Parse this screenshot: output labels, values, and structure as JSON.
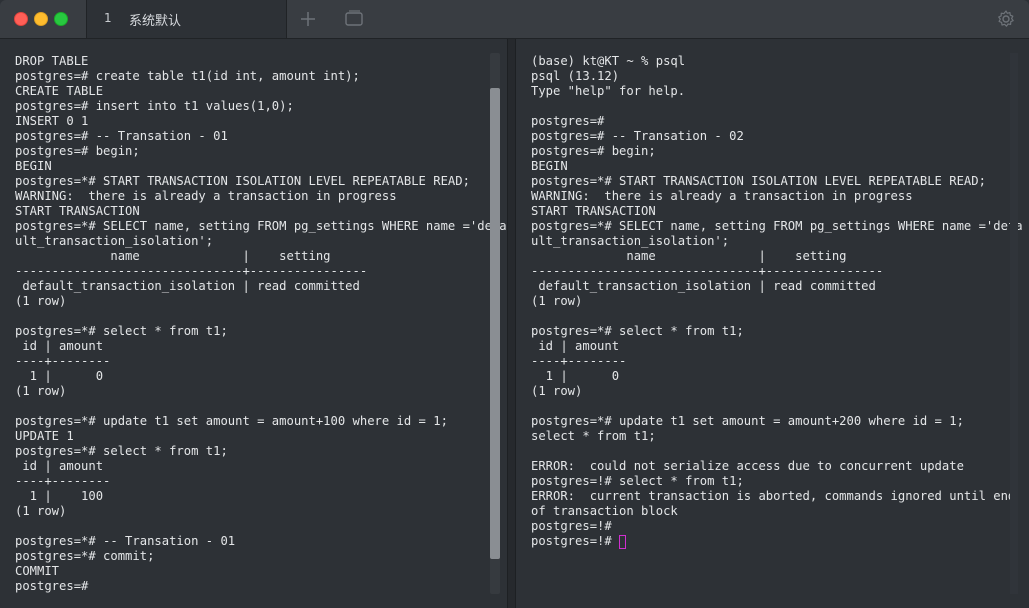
{
  "window": {
    "tab": {
      "number": "1",
      "title": "系统默认"
    },
    "icons": {
      "close": "close-button",
      "minimize": "minimize-button",
      "zoom": "zoom-button",
      "new_tab": "plus-icon",
      "overview": "tab-overview-icon",
      "settings": "gear-icon"
    },
    "colors": {
      "cursor": "#d02fd0",
      "text": "#e4e6e8",
      "background": "#2d3136"
    }
  },
  "left_pane": {
    "scrollbar": {
      "position_fraction": 0.13,
      "visible_fraction": 0.87
    },
    "lines": [
      "DROP TABLE",
      "postgres=# create table t1(id int, amount int);",
      "CREATE TABLE",
      "postgres=# insert into t1 values(1,0);",
      "INSERT 0 1",
      "postgres=# -- Transation - 01",
      "postgres=# begin;",
      "BEGIN",
      "postgres=*# START TRANSACTION ISOLATION LEVEL REPEATABLE READ;",
      "WARNING:  there is already a transaction in progress",
      "START TRANSACTION",
      "postgres=*# SELECT name, setting FROM pg_settings WHERE name ='defa",
      "ult_transaction_isolation';",
      "             name              |    setting",
      "-------------------------------+----------------",
      " default_transaction_isolation | read committed",
      "(1 row)",
      "",
      "postgres=*# select * from t1;",
      " id | amount",
      "----+--------",
      "  1 |      0",
      "(1 row)",
      "",
      "postgres=*# update t1 set amount = amount+100 where id = 1;",
      "UPDATE 1",
      "postgres=*# select * from t1;",
      " id | amount",
      "----+--------",
      "  1 |    100",
      "(1 row)",
      "",
      "postgres=*# -- Transation - 01",
      "postgres=*# commit;",
      "COMMIT",
      "postgres=#"
    ]
  },
  "right_pane": {
    "lines": [
      "(base) kt@KT ~ % psql",
      "psql (13.12)",
      "Type \"help\" for help.",
      "",
      "postgres=#",
      "postgres=# -- Transation - 02",
      "postgres=# begin;",
      "BEGIN",
      "postgres=*# START TRANSACTION ISOLATION LEVEL REPEATABLE READ;",
      "WARNING:  there is already a transaction in progress",
      "START TRANSACTION",
      "postgres=*# SELECT name, setting FROM pg_settings WHERE name ='defa",
      "ult_transaction_isolation';",
      "             name              |    setting",
      "-------------------------------+----------------",
      " default_transaction_isolation | read committed",
      "(1 row)",
      "",
      "postgres=*# select * from t1;",
      " id | amount",
      "----+--------",
      "  1 |      0",
      "(1 row)",
      "",
      "postgres=*# update t1 set amount = amount+200 where id = 1;",
      "select * from t1;",
      "",
      "ERROR:  could not serialize access due to concurrent update",
      "postgres=!# select * from t1;",
      "ERROR:  current transaction is aborted, commands ignored until end",
      "of transaction block",
      "postgres=!#",
      "postgres=!# "
    ]
  }
}
